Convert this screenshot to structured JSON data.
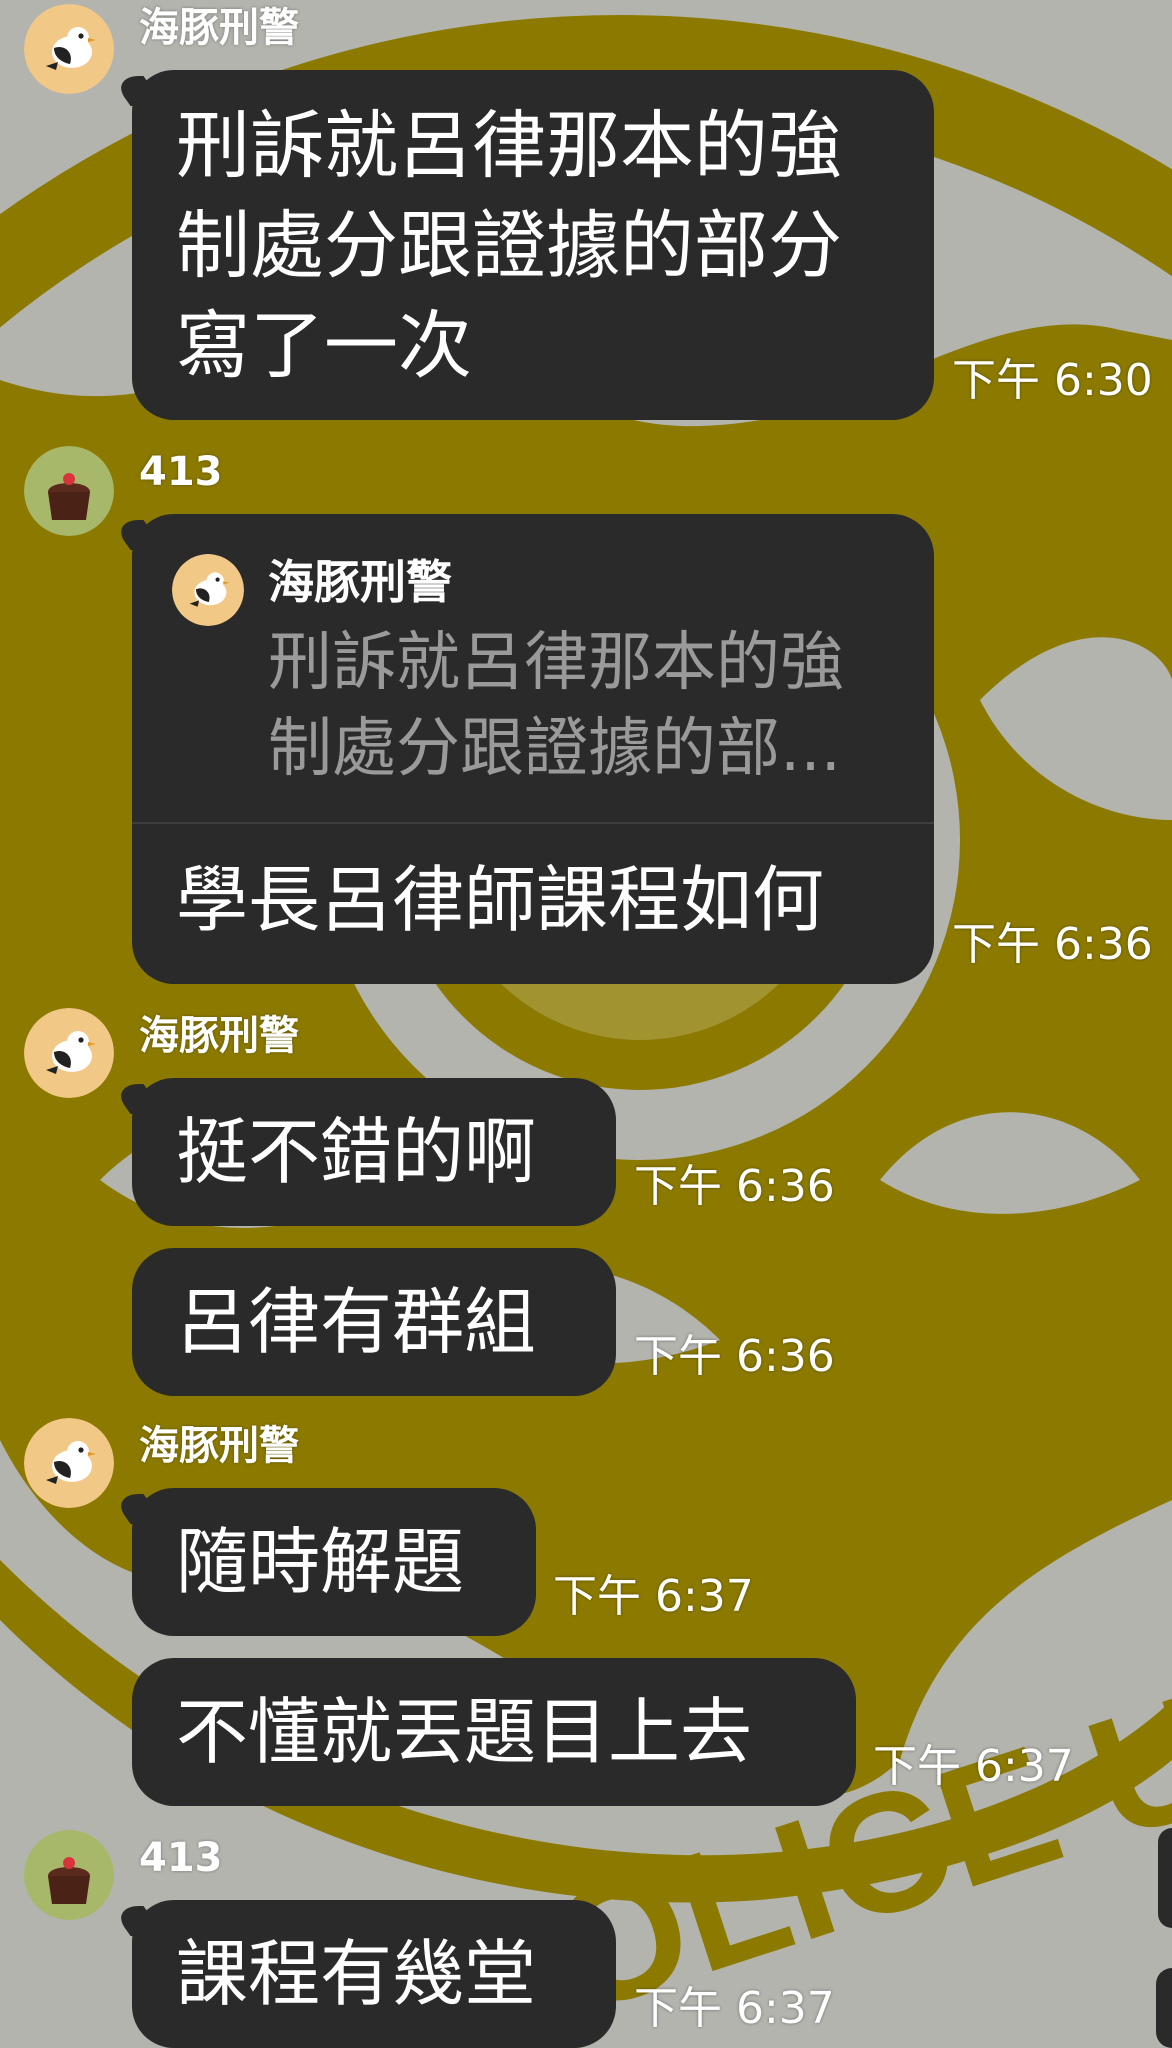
{
  "colors": {
    "bubble": "#2a2a2a",
    "wallpaper_gray": "#b4b4ae",
    "wallpaper_gold": "#8c7a00",
    "text": "#ffffff",
    "quote_text": "#9a9a9a"
  },
  "background_text": "POLICE UN",
  "messages": [
    {
      "sender": "海豚刑警",
      "avatar": "bird-avatar-icon",
      "text": "刑訴就呂律那本的強制處分跟證據的部分寫了一次",
      "time": "下午 6:30"
    },
    {
      "sender": "413",
      "avatar": "cake-avatar-icon",
      "quote": {
        "sender": "海豚刑警",
        "text": "刑訴就呂律那本的強制處分跟證據的部..."
      },
      "text": "學長呂律師課程如何",
      "time": "下午 6:36"
    },
    {
      "sender": "海豚刑警",
      "avatar": "bird-avatar-icon",
      "text": "挺不錯的啊",
      "time": "下午 6:36"
    },
    {
      "text": "呂律有群組",
      "time": "下午 6:36"
    },
    {
      "sender": "海豚刑警",
      "avatar": "bird-avatar-icon",
      "text": "隨時解題",
      "time": "下午 6:37"
    },
    {
      "text": "不懂就丟題目上去",
      "time": "下午 6:37"
    },
    {
      "sender": "413",
      "avatar": "cake-avatar-icon",
      "text": "課程有幾堂",
      "time": "下午 6:37"
    }
  ]
}
